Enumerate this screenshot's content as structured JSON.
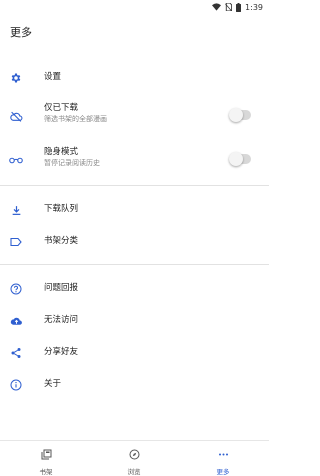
{
  "status_bar": {
    "time": "1:39"
  },
  "app_bar": {
    "title": "更多"
  },
  "menu": {
    "settings": {
      "label": "设置"
    },
    "downloaded_only": {
      "label": "仅已下载",
      "subtitle": "筛选书架的全部漫画",
      "enabled": false
    },
    "incognito": {
      "label": "隐身模式",
      "subtitle": "暂停记录阅读历史",
      "enabled": false
    },
    "download_queue": {
      "label": "下载队列"
    },
    "categories": {
      "label": "书架分类"
    },
    "report": {
      "label": "问题回报"
    },
    "no_access": {
      "label": "无法访问"
    },
    "share": {
      "label": "分享好友"
    },
    "about": {
      "label": "关于"
    }
  },
  "bottom_nav": {
    "items": [
      {
        "label": "书架",
        "icon": "library-icon"
      },
      {
        "label": "浏览",
        "icon": "compass-icon"
      },
      {
        "label": "更多",
        "icon": "more-horizontal-icon",
        "active": true
      }
    ]
  },
  "colors": {
    "accent": "#2f5fd0"
  }
}
